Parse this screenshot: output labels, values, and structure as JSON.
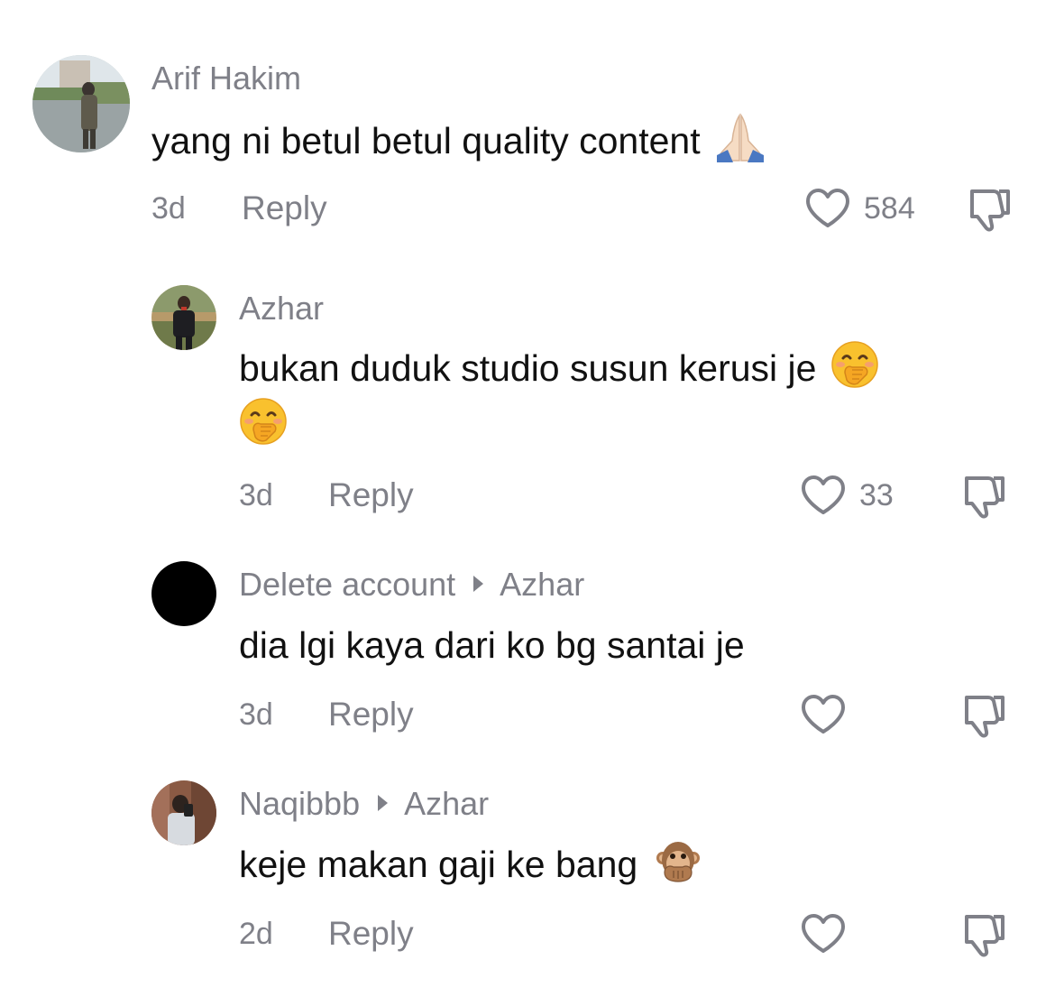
{
  "colors": {
    "muted": "#7f8088",
    "text": "#111111",
    "background": "#ffffff"
  },
  "comments": [
    {
      "username": "Arif Hakim",
      "reply_to": "",
      "text": "yang ni betul betul quality content",
      "emoji": "folded-hands-icon",
      "age": "3d",
      "reply_label": "Reply",
      "likes": "584"
    },
    {
      "username": "Azhar",
      "reply_to": "",
      "text_line1": "bukan duduk studio susun kerusi je",
      "emoji": "hand-over-mouth-icon",
      "age": "3d",
      "reply_label": "Reply",
      "likes": "33"
    },
    {
      "username": "Delete account",
      "reply_to": "Azhar",
      "text": "dia lgi kaya dari ko bg santai je",
      "age": "3d",
      "reply_label": "Reply",
      "likes": ""
    },
    {
      "username": "Naqibbb",
      "reply_to": "Azhar",
      "text": "keje makan gaji ke bang",
      "emoji": "speak-no-evil-monkey-icon",
      "age": "2d",
      "reply_label": "Reply",
      "likes": ""
    }
  ]
}
